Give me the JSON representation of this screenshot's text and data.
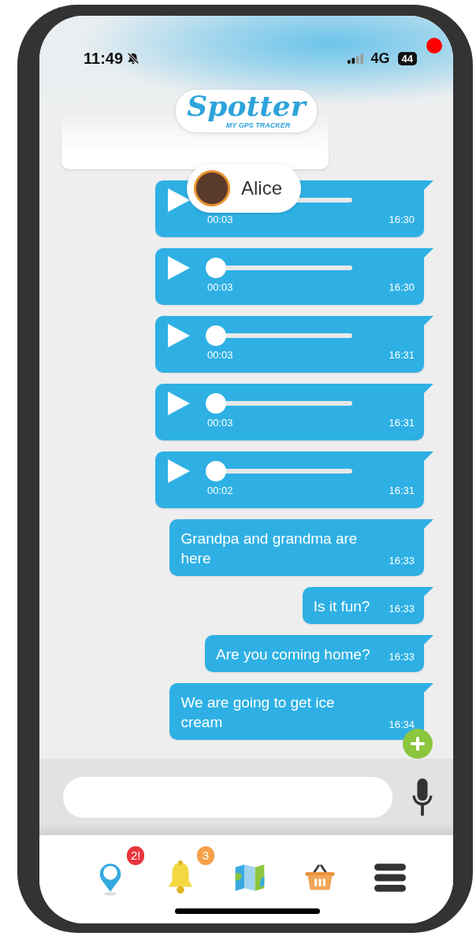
{
  "status_bar": {
    "time": "11:49",
    "silent": true,
    "network": "4G",
    "battery": "44",
    "recording": true
  },
  "logo": {
    "name": "Spotter",
    "tagline": "MY GPS TRACKER"
  },
  "contact": {
    "name": "Alice"
  },
  "messages": [
    {
      "kind": "card"
    },
    {
      "kind": "audio",
      "duration": "00:03",
      "time": "16:30",
      "level": 0
    },
    {
      "kind": "audio",
      "duration": "00:03",
      "time": "16:30",
      "level": 0
    },
    {
      "kind": "audio",
      "duration": "00:03",
      "time": "16:31",
      "level": 0
    },
    {
      "kind": "audio",
      "duration": "00:03",
      "time": "16:31",
      "level": 0
    },
    {
      "kind": "audio",
      "duration": "00:02",
      "time": "16:31",
      "level": 0
    },
    {
      "kind": "text",
      "text": "Grandpa and grandma are here",
      "time": "16:33"
    },
    {
      "kind": "text",
      "text": "Is it fun?",
      "time": "16:33"
    },
    {
      "kind": "text",
      "text": "Are you coming home?",
      "time": "16:33"
    },
    {
      "kind": "text",
      "text": "We are going to get ice cream",
      "time": "16:34"
    }
  ],
  "nav": [
    {
      "kind": "pin",
      "badge": "2!",
      "color": "#e8353d"
    },
    {
      "kind": "bell",
      "badge": "3",
      "color": "#f5a04a"
    },
    {
      "kind": "map"
    },
    {
      "kind": "basket"
    },
    {
      "kind": "menu"
    }
  ]
}
